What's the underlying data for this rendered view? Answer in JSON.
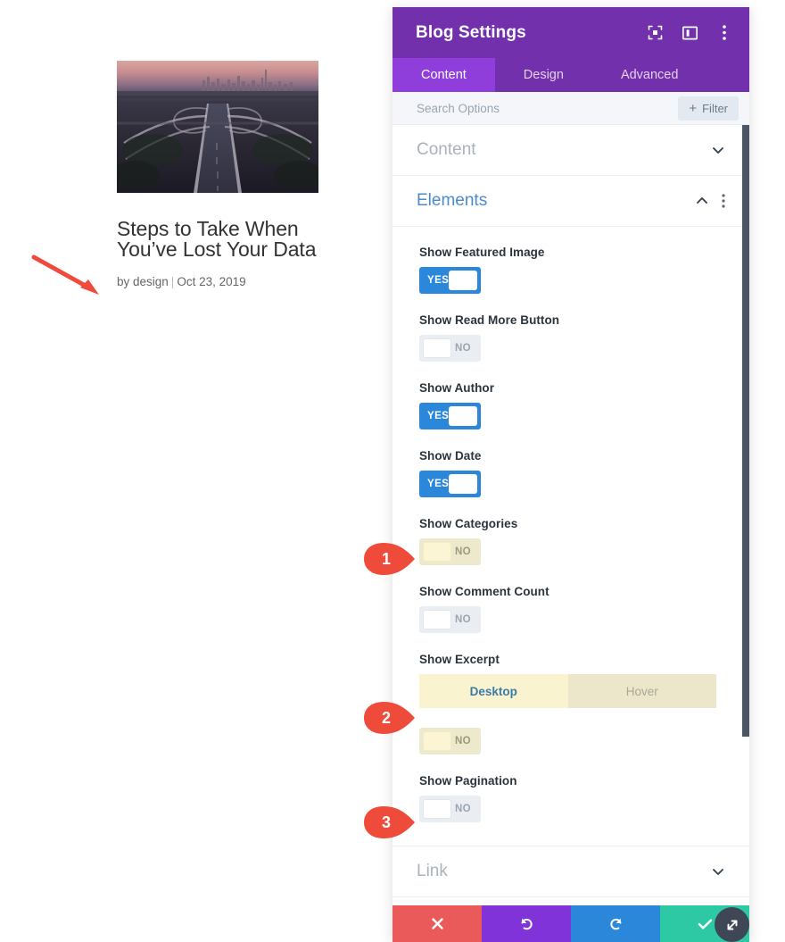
{
  "preview": {
    "featured_image_alt": "aerial-highway-interchange-at-dusk",
    "post_title": "Steps to Take When You’ve Lost Your Data",
    "post_author_prefix": "by design",
    "post_meta_separator": "|",
    "post_date": "Oct 23, 2019",
    "annotation_arrow": "red-arrow-pointing-to-post-meta"
  },
  "panel": {
    "title": "Blog Settings",
    "header_icons": [
      {
        "name": "focus-target-icon",
        "label": "Focus"
      },
      {
        "name": "panel-layout-icon",
        "label": "Layout"
      },
      {
        "name": "more-options-icon",
        "label": "More"
      }
    ],
    "tabs": [
      {
        "label": "Content",
        "active": true
      },
      {
        "label": "Design",
        "active": false
      },
      {
        "label": "Advanced",
        "active": false
      }
    ],
    "search": {
      "value": "",
      "placeholder": "Search Options"
    },
    "filter_button": {
      "label": "Filter",
      "plus": "+"
    },
    "accordions": [
      {
        "title": "Content",
        "state": "collapsed"
      },
      {
        "title": "Elements",
        "state": "expanded"
      },
      {
        "title": "Link",
        "state": "collapsed"
      }
    ],
    "elements_fields": [
      {
        "label": "Show Featured Image",
        "type": "toggle",
        "value": "YES",
        "state": "on",
        "modified": false
      },
      {
        "label": "Show Read More Button",
        "type": "toggle",
        "value": "NO",
        "state": "off",
        "modified": false
      },
      {
        "label": "Show Author",
        "type": "toggle",
        "value": "YES",
        "state": "on",
        "modified": false
      },
      {
        "label": "Show Date",
        "type": "toggle",
        "value": "YES",
        "state": "on",
        "modified": false
      },
      {
        "label": "Show Categories",
        "type": "toggle",
        "value": "NO",
        "state": "off",
        "modified": true
      },
      {
        "label": "Show Comment Count",
        "type": "toggle",
        "value": "NO",
        "state": "off",
        "modified": false
      },
      {
        "label": "Show Excerpt",
        "type": "state-tabs-toggle",
        "state_tabs": [
          {
            "label": "Desktop",
            "active": true
          },
          {
            "label": "Hover",
            "active": false
          }
        ],
        "value": "NO",
        "state": "off",
        "modified": true
      },
      {
        "label": "Show Pagination",
        "type": "toggle",
        "value": "NO",
        "state": "off",
        "modified": false
      }
    ],
    "action_bar": [
      {
        "name": "close-button",
        "icon": "close-x-icon",
        "color": "#ea5a5a"
      },
      {
        "name": "undo-button",
        "icon": "undo-arrow-icon",
        "color": "#8033d9"
      },
      {
        "name": "redo-button",
        "icon": "redo-arrow-icon",
        "color": "#2b87da"
      },
      {
        "name": "save-button",
        "icon": "checkmark-icon",
        "color": "#2cc9a4"
      }
    ],
    "resize_handle_icon": "diagonal-resize-icon",
    "scrollbar": {
      "orientation": "vertical",
      "position": "top"
    }
  },
  "callouts": [
    {
      "number": "1",
      "target": "Show Categories toggle"
    },
    {
      "number": "2",
      "target": "Show Excerpt Desktop tab"
    },
    {
      "number": "3",
      "target": "Show Pagination toggle"
    }
  ],
  "colors": {
    "brand_purple": "#7230ad",
    "tab_active_purple": "#8f3ddb",
    "toggle_on_blue": "#2b87da",
    "accent_link_blue": "#4c8bcb",
    "modified_yellow": "#faf3cf",
    "callout_red": "#ee4b3a",
    "save_teal": "#2cc9a4"
  }
}
